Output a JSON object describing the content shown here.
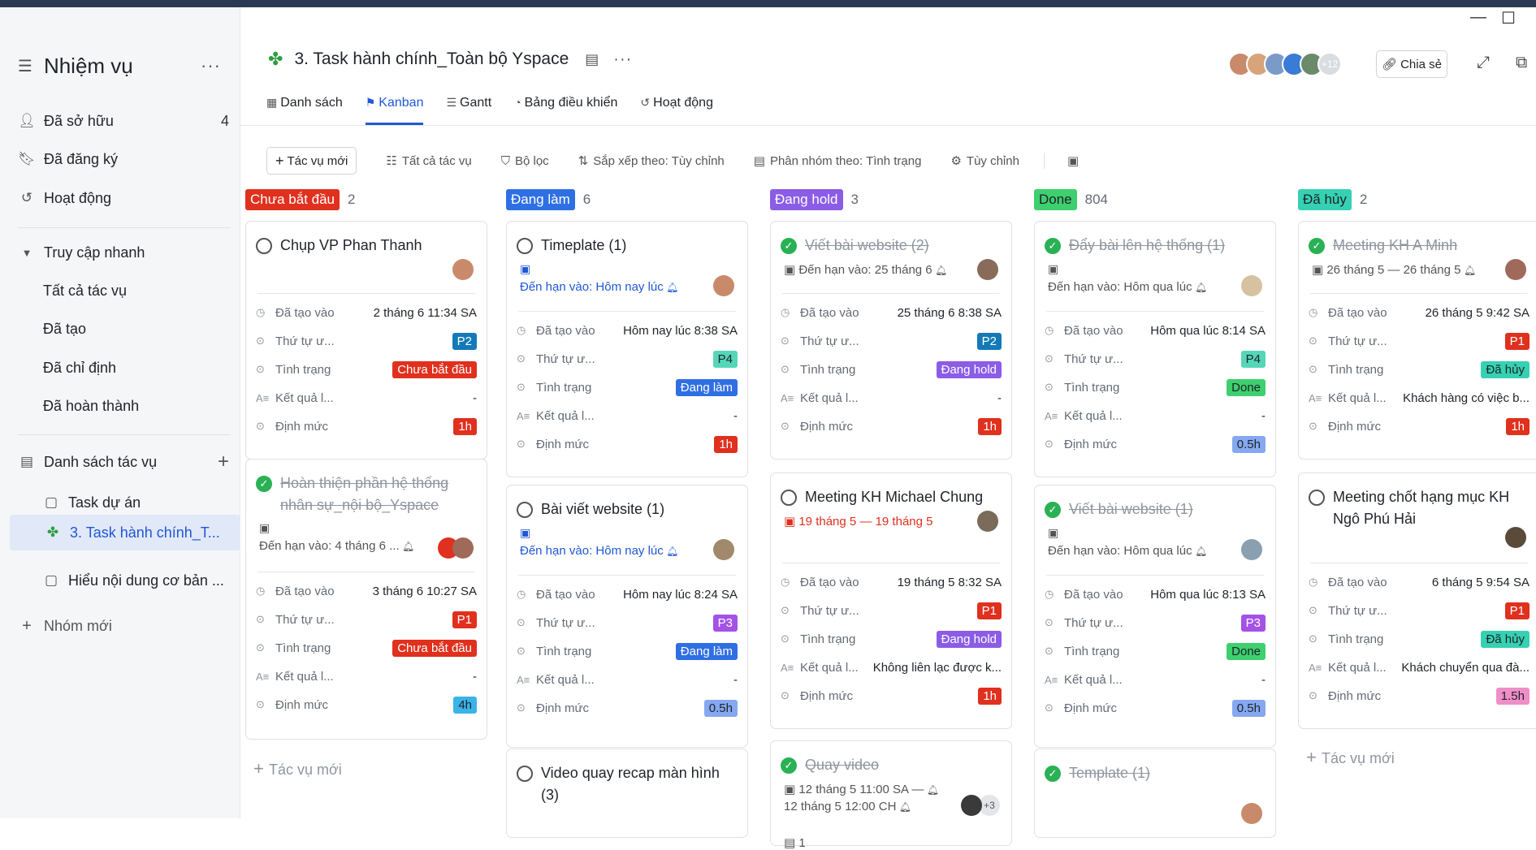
{
  "window": {
    "minimize": "—",
    "maximize": "☐"
  },
  "sidebar": {
    "title": "Nhiệm vụ",
    "items": [
      {
        "label": "Đã sở hữu",
        "count": "4"
      },
      {
        "label": "Đã đăng ký"
      },
      {
        "label": "Hoạt động"
      }
    ],
    "quick_access": {
      "label": "Truy cập nhanh",
      "items": [
        "Tất cả tác vụ",
        "Đã tạo",
        "Đã chỉ định",
        "Đã hoàn thành"
      ]
    },
    "task_lists": {
      "label": "Danh sách tác vụ",
      "items": [
        "Task dự án",
        "3. Task hành chính_T...",
        "Hiểu nội dung cơ bản ..."
      ]
    },
    "new_group": "Nhóm mới"
  },
  "header": {
    "title": "3. Task hành chính_Toàn bộ Yspace",
    "members_more": "+12",
    "share_label": "Chia sẻ",
    "tabs": [
      "Danh sách",
      "Kanban",
      "Gantt",
      "Bảng điều khiển",
      "Hoạt động"
    ]
  },
  "toolbar": {
    "new_task": "Tác vụ mới",
    "all_tasks": "Tất cả tác vụ",
    "filter": "Bộ lọc",
    "sort": "Sắp xếp theo: Tùy chỉnh",
    "group": "Phân nhóm theo: Tình trạng",
    "customize": "Tùy chỉnh"
  },
  "fields": {
    "created": "Đã tạo vào",
    "priority": "Thứ tự ư...",
    "status": "Tình trạng",
    "result": "Kết quả l...",
    "quota": "Định mức"
  },
  "add_task": "Tác vụ mới",
  "colors": {
    "red": "#e0301e",
    "blue": "#2f6fe4",
    "purple": "#8b5ce6",
    "green": "#3ecf6f",
    "teal": "#35d1b2",
    "p1": "#e0301e",
    "p2": "#1479b8",
    "p3": "#a452e6",
    "p4": "#55d6b8",
    "h1": "#e0301e",
    "h4": "#3ab4e8",
    "h05": "#86a8f0",
    "h15": "#f08ec8"
  },
  "columns": [
    {
      "name": "Chưa bắt đầu",
      "count": "2",
      "cards": [
        {
          "title": "Chụp VP Phan Thanh",
          "created": "2 tháng 6 11:34 SA",
          "priority": "P2",
          "status": "Chưa bắt đầu",
          "result": "-",
          "quota": "1h"
        },
        {
          "title": "Hoàn thiện phần hệ thống nhân sự_nội bộ_Yspace",
          "due": "Đến hạn vào: 4 tháng 6 ...",
          "created": "3 tháng 6 10:27 SA",
          "priority": "P1",
          "status": "Chưa bắt đầu",
          "result": "-",
          "quota": "4h"
        }
      ]
    },
    {
      "name": "Đang làm",
      "count": "6",
      "cards": [
        {
          "title": "Timeplate (1)",
          "due": "Đến hạn vào: Hôm nay lúc",
          "created": "Hôm nay lúc 8:38 SA",
          "priority": "P4",
          "status": "Đang làm",
          "result": "-",
          "quota": "1h"
        },
        {
          "title": "Bài viết website (1)",
          "due": "Đến hạn vào: Hôm nay lúc",
          "created": "Hôm nay lúc 8:24 SA",
          "priority": "P3",
          "status": "Đang làm",
          "result": "-",
          "quota": "0.5h"
        },
        {
          "title": "Video quay recap màn hình (3)"
        }
      ]
    },
    {
      "name": "Đang hold",
      "count": "3",
      "cards": [
        {
          "title": "Viết bài website (2)",
          "due": "Đến hạn vào: 25 tháng 6",
          "created": "25 tháng 6 8:38 SA",
          "priority": "P2",
          "status": "Đang hold",
          "result": "-",
          "quota": "1h"
        },
        {
          "title": "Meeting KH Michael Chung",
          "due": "19 tháng 5 — 19 tháng 5",
          "created": "19 tháng 5 8:32 SA",
          "priority": "P1",
          "status": "Đang hold",
          "result": "Không liên lạc được k...",
          "quota": "1h"
        },
        {
          "title": "Quay video",
          "due": "12 tháng 5 11:00 SA —",
          "due2": "12 tháng 5 12:00 CH",
          "more": "+3",
          "sub": "1"
        }
      ]
    },
    {
      "name": "Done",
      "count": "804",
      "cards": [
        {
          "title": "Đẩy bài lên hệ thống (1)",
          "due": "Đến hạn vào: Hôm qua lúc",
          "created": "Hôm qua lúc 8:14 SA",
          "priority": "P4",
          "status": "Done",
          "result": "-",
          "quota": "0.5h"
        },
        {
          "title": "Viết bài website (1)",
          "due": "Đến hạn vào: Hôm qua lúc",
          "created": "Hôm qua lúc 8:13 SA",
          "priority": "P3",
          "status": "Done",
          "result": "-",
          "quota": "0.5h"
        },
        {
          "title": "Template (1)"
        }
      ]
    },
    {
      "name": "Đã hủy",
      "count": "2",
      "cards": [
        {
          "title": "Meeting KH A Minh",
          "due": "26 tháng 5 — 26 tháng 5",
          "created": "26 tháng 5 9:42 SA",
          "priority": "P1",
          "status": "Đã hủy",
          "result": "Khách hàng có việc b...",
          "quota": "1h"
        },
        {
          "title": "Meeting chốt hạng mục KH Ngô Phú Hải",
          "created": "6 tháng 5 9:54 SA",
          "priority": "P1",
          "status": "Đã hủy",
          "result": "Khách chuyển qua đà...",
          "quota": "1.5h"
        }
      ]
    }
  ]
}
